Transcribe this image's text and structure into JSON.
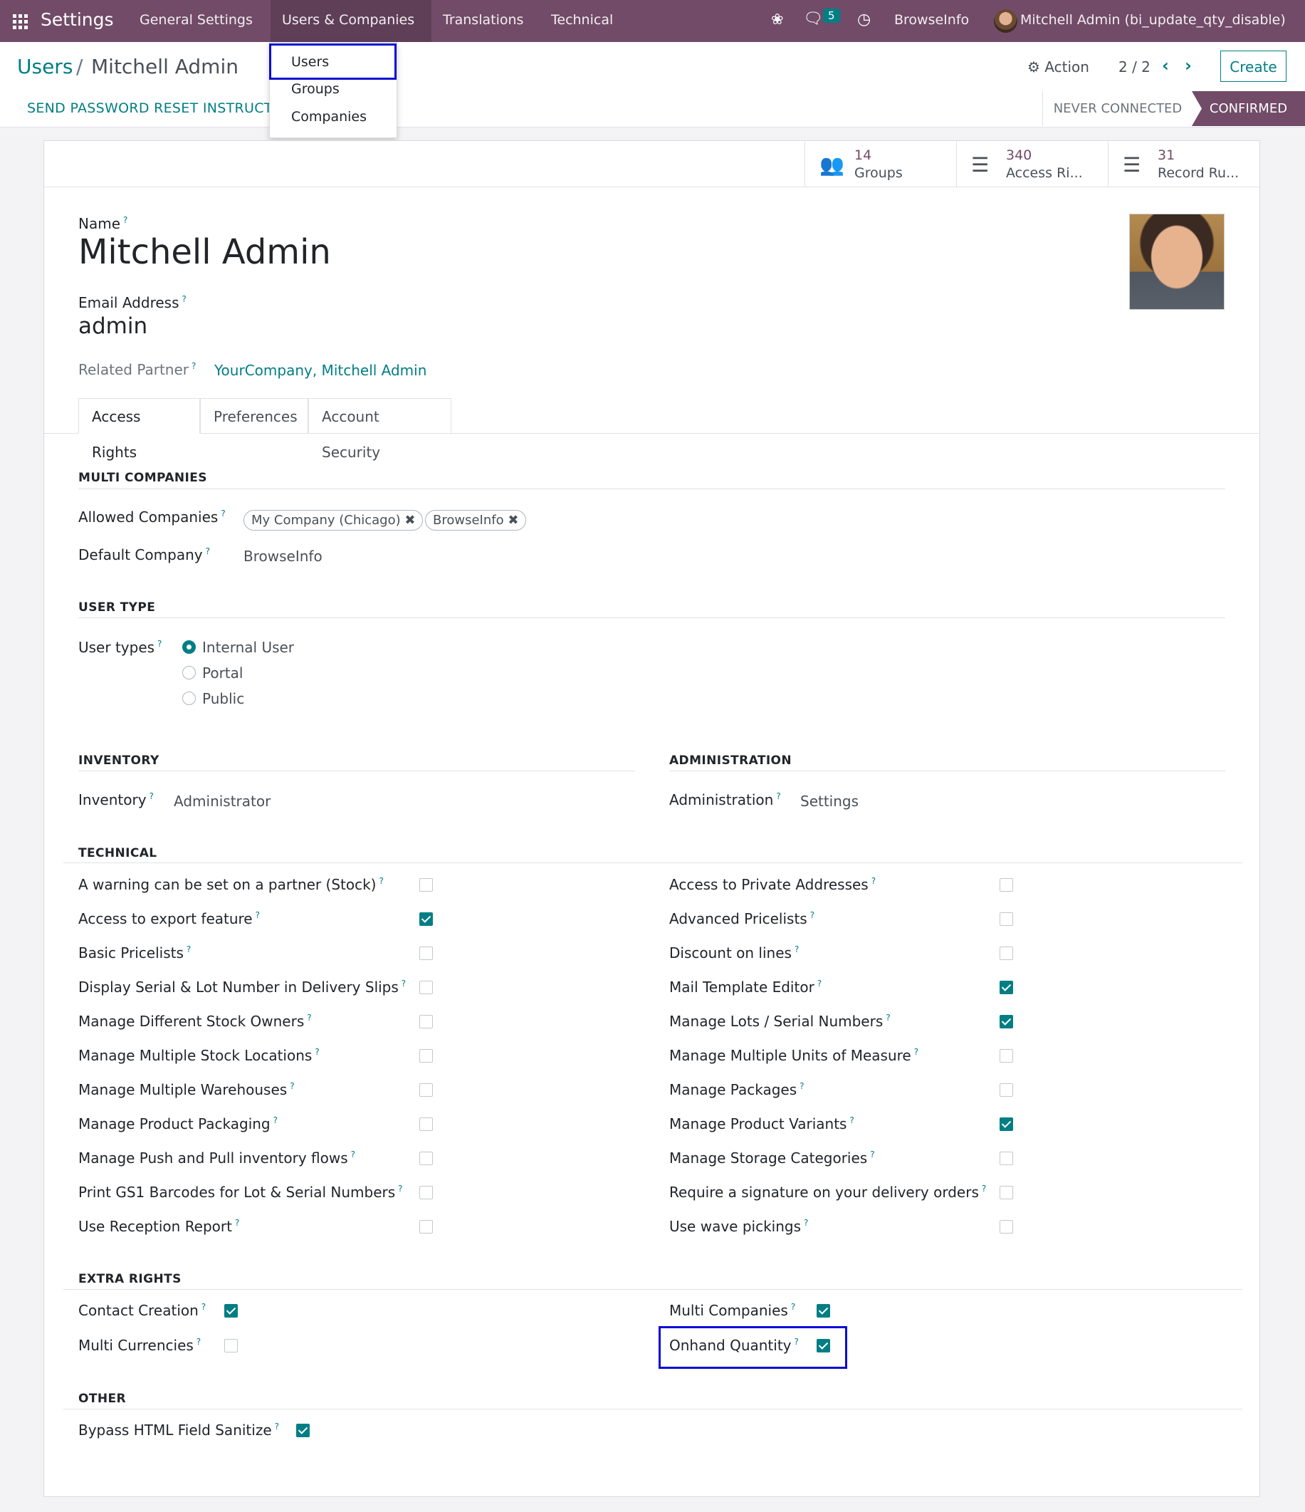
{
  "navbar": {
    "brand": "Settings",
    "menu": [
      "General Settings",
      "Users & Companies",
      "Translations",
      "Technical"
    ],
    "chat_count": "5",
    "company": "BrowseInfo",
    "user": "Mitchell Admin (bi_update_qty_disable)",
    "color": "#714b67"
  },
  "dropdown": {
    "items": [
      "Users",
      "Groups",
      "Companies"
    ]
  },
  "breadcrumb": {
    "parent": "Users",
    "separator": "/",
    "current": "Mitchell Admin"
  },
  "control": {
    "action": "Action",
    "pager": "2 / 2",
    "create": "Create"
  },
  "statusbar": {
    "reset_button": "SEND PASSWORD RESET INSTRUCT",
    "states": [
      "NEVER CONNECTED",
      "CONFIRMED"
    ],
    "active_state": "CONFIRMED"
  },
  "smart_buttons": [
    {
      "count": "14",
      "label": "Groups",
      "icon": "users-icon"
    },
    {
      "count": "340",
      "label": "Access Ri...",
      "icon": "list-icon"
    },
    {
      "count": "31",
      "label": "Record Ru...",
      "icon": "list-ul-icon"
    }
  ],
  "form": {
    "name_label": "Name",
    "name": "Mitchell Admin",
    "email_label": "Email Address",
    "email": "admin",
    "partner_label": "Related Partner",
    "partner": "YourCompany, Mitchell Admin",
    "help": "?"
  },
  "tabs": [
    "Access Rights",
    "Preferences",
    "Account Security"
  ],
  "multi_companies": {
    "title": "MULTI COMPANIES",
    "allowed_label": "Allowed Companies",
    "allowed": [
      "My Company (Chicago)",
      "BrowseInfo"
    ],
    "default_label": "Default Company",
    "default": "BrowseInfo"
  },
  "user_type": {
    "title": "USER TYPE",
    "label": "User types",
    "options": [
      "Internal User",
      "Portal",
      "Public"
    ],
    "selected": "Internal User"
  },
  "inventory": {
    "title": "INVENTORY",
    "label": "Inventory",
    "value": "Administrator"
  },
  "administration": {
    "title": "ADMINISTRATION",
    "label": "Administration",
    "value": "Settings"
  },
  "technical": {
    "title": "TECHNICAL",
    "left": [
      {
        "label": "A warning can be set on a partner (Stock)",
        "checked": false
      },
      {
        "label": "Access to export feature",
        "checked": true
      },
      {
        "label": "Basic Pricelists",
        "checked": false
      },
      {
        "label": "Display Serial & Lot Number in Delivery Slips",
        "checked": false
      },
      {
        "label": "Manage Different Stock Owners",
        "checked": false
      },
      {
        "label": "Manage Multiple Stock Locations",
        "checked": false
      },
      {
        "label": "Manage Multiple Warehouses",
        "checked": false
      },
      {
        "label": "Manage Product Packaging",
        "checked": false
      },
      {
        "label": "Manage Push and Pull inventory flows",
        "checked": false
      },
      {
        "label": "Print GS1 Barcodes for Lot & Serial Numbers",
        "checked": false
      },
      {
        "label": "Use Reception Report",
        "checked": false
      }
    ],
    "right": [
      {
        "label": "Access to Private Addresses",
        "checked": false
      },
      {
        "label": "Advanced Pricelists",
        "checked": false
      },
      {
        "label": "Discount on lines",
        "checked": false
      },
      {
        "label": "Mail Template Editor",
        "checked": true
      },
      {
        "label": "Manage Lots / Serial Numbers",
        "checked": true
      },
      {
        "label": "Manage Multiple Units of Measure",
        "checked": false
      },
      {
        "label": "Manage Packages",
        "checked": false
      },
      {
        "label": "Manage Product Variants",
        "checked": true
      },
      {
        "label": "Manage Storage Categories",
        "checked": false
      },
      {
        "label": "Require a signature on your delivery orders",
        "checked": false
      },
      {
        "label": "Use wave pickings",
        "checked": false
      }
    ]
  },
  "extra_rights": {
    "title": "EXTRA RIGHTS",
    "left": [
      {
        "label": "Contact Creation",
        "checked": true
      },
      {
        "label": "Multi Currencies",
        "checked": false
      }
    ],
    "right": [
      {
        "label": "Multi Companies",
        "checked": true
      },
      {
        "label": "Onhand Quantity",
        "checked": true
      }
    ]
  },
  "other": {
    "title": "OTHER",
    "items": [
      {
        "label": "Bypass HTML Field Sanitize",
        "checked": true
      }
    ]
  },
  "colors": {
    "accent": "#017e84",
    "highlight": "#0a0ad6"
  }
}
